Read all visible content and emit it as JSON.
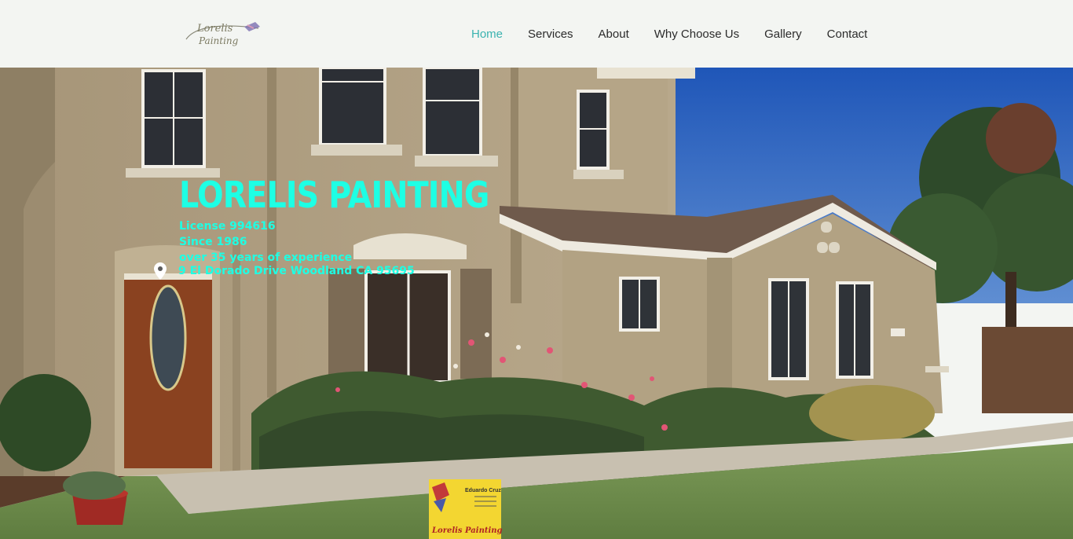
{
  "header": {
    "logo_alt": "Lorelis Painting",
    "nav": [
      {
        "label": "Home",
        "active": true
      },
      {
        "label": "Services",
        "active": false
      },
      {
        "label": "About",
        "active": false
      },
      {
        "label": "Why Choose Us",
        "active": false
      },
      {
        "label": "Gallery",
        "active": false
      },
      {
        "label": "Contact",
        "active": false
      }
    ]
  },
  "hero": {
    "title": "LORELIS PAINTING",
    "license": "License 994616",
    "since": "Since 1986",
    "experience": "over 35 years of experience",
    "address": "9 El Dorado Drive Woodland CA 95695",
    "sign_name": "Eduardo Cruz",
    "sign_brand": "Lorelis Painting"
  },
  "colors": {
    "accent_nav": "#3bb3b0",
    "hero_text": "#1effe4",
    "header_bg": "#f3f5f2"
  }
}
